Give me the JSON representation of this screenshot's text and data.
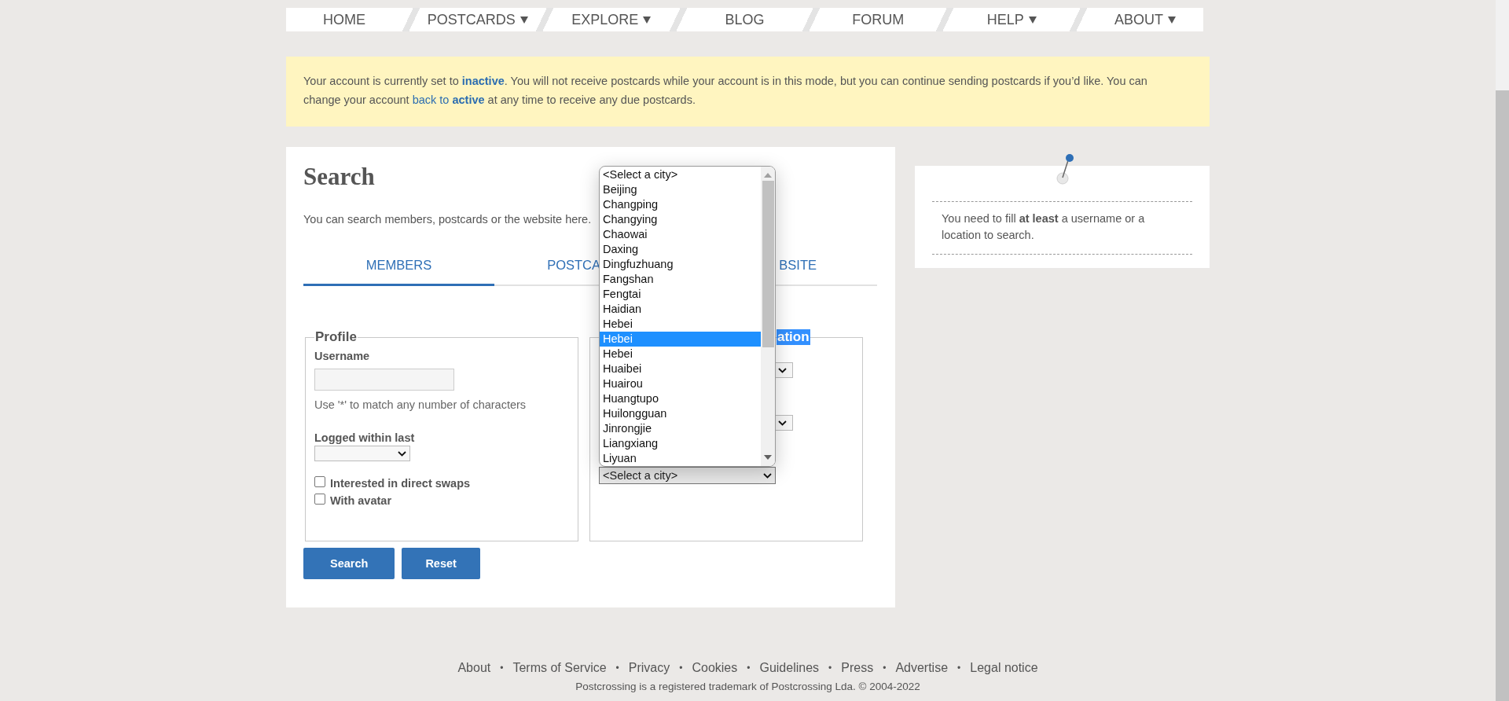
{
  "nav": [
    {
      "label": "HOME",
      "has_menu": false
    },
    {
      "label": "POSTCARDS",
      "has_menu": true
    },
    {
      "label": "EXPLORE",
      "has_menu": true
    },
    {
      "label": "BLOG",
      "has_menu": false
    },
    {
      "label": "FORUM",
      "has_menu": false
    },
    {
      "label": "HELP",
      "has_menu": true
    },
    {
      "label": "ABOUT",
      "has_menu": true
    }
  ],
  "notice": [
    {
      "kind": "plain",
      "text": "Your account is currently set to "
    },
    {
      "kind": "strong-link",
      "text": "inactive"
    },
    {
      "kind": "plain",
      "text": ". You will not receive postcards while your account is in this mode, but you can continue sending postcards if you’d like. You can change your account "
    },
    {
      "kind": "link",
      "text": "back to"
    },
    {
      "kind": "strong-link",
      "text": "active"
    },
    {
      "kind": "plain",
      "text": " at any time to receive any due postcards."
    }
  ],
  "search": {
    "title": "Search",
    "description": "You can search members, postcards or the website here.",
    "tabs": [
      {
        "label": "MEMBERS",
        "selected": true
      },
      {
        "label": "POSTCA",
        "selected": false
      },
      {
        "label": "BSITE",
        "selected": false
      }
    ],
    "profile": {
      "legend": "Profile",
      "username_label": "Username",
      "username_hint": "Use '*' to match any number of characters",
      "logged_label": "Logged within last",
      "checkboxes": [
        {
          "label": "Interested in direct swaps",
          "checked": false
        },
        {
          "label": "With avatar",
          "checked": false
        }
      ]
    },
    "location": {
      "legend": "ation",
      "city_select": "<Select a city>",
      "city_options": [
        {
          "label": "<Select a city>",
          "selected": false
        },
        {
          "label": "Beijing",
          "selected": false
        },
        {
          "label": "Changping",
          "selected": false
        },
        {
          "label": "Changying",
          "selected": false
        },
        {
          "label": "Chaowai",
          "selected": false
        },
        {
          "label": "Daxing",
          "selected": false
        },
        {
          "label": "Dingfuzhuang",
          "selected": false
        },
        {
          "label": "Fangshan",
          "selected": false
        },
        {
          "label": "Fengtai",
          "selected": false
        },
        {
          "label": "Haidian",
          "selected": false
        },
        {
          "label": "Hebei",
          "selected": false
        },
        {
          "label": "Hebei",
          "selected": true
        },
        {
          "label": "Hebei",
          "selected": false
        },
        {
          "label": "Huaibei",
          "selected": false
        },
        {
          "label": "Huairou",
          "selected": false
        },
        {
          "label": "Huangtupo",
          "selected": false
        },
        {
          "label": "Huilongguan",
          "selected": false
        },
        {
          "label": "Jinrongjie",
          "selected": false
        },
        {
          "label": "Liangxiang",
          "selected": false
        },
        {
          "label": "Liyuan",
          "selected": false
        }
      ]
    },
    "buttons": [
      "Search",
      "Reset"
    ]
  },
  "tip": "You need to fill **at least** a username or a location to search.",
  "footer": {
    "links": [
      "About",
      "Terms of Service",
      "Privacy",
      "Cookies",
      "Guidelines",
      "Press",
      "Advertise",
      "Legal notice"
    ],
    "separator": "•",
    "copyright": "Postcrossing is a registered trademark of Postcrossing Lda. © 2004-2022"
  }
}
